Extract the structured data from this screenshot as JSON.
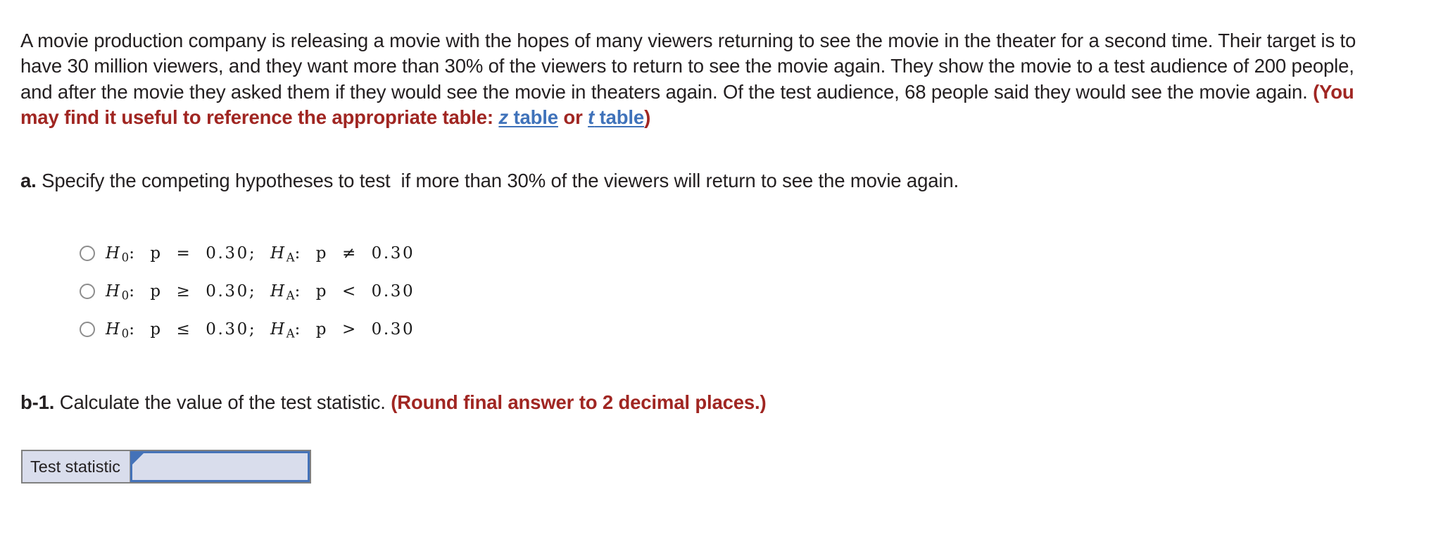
{
  "problem": {
    "text_part_1": "A movie production company is releasing a movie with the hopes of many viewers returning to see the movie in the theater for a second time. Their target is to have 30 million viewers, and they want more than 30% of the viewers to return to see the movie again. They show the movie to a test audience of 200 people, and after the movie they asked them if they would see the movie in theaters again. Of the test audience, 68 people said they would see the movie again. ",
    "reference_note_open": "(You may find it useful to reference the appropriate table: ",
    "z_table_prefix": "z",
    "z_table_suffix": " table",
    "conjunction": " or ",
    "t_table_prefix": "t",
    "t_table_suffix": " table",
    "reference_note_close": ")"
  },
  "part_a": {
    "label": "a.",
    "question": " Specify the competing hypotheses to test  if more than 30% of the viewers will return to see the movie again.",
    "options": [
      {
        "id": "option-1",
        "null_symbol": "H",
        "null_sub": "0",
        "null_body": ":  p  =  0.30;  ",
        "alt_symbol": "H",
        "alt_sub": "A",
        "alt_body": ":  p  ≠  0.30",
        "selected": false
      },
      {
        "id": "option-2",
        "null_symbol": "H",
        "null_sub": "0",
        "null_body": ":  p  ≥  0.30;  ",
        "alt_symbol": "H",
        "alt_sub": "A",
        "alt_body": ":  p  <  0.30",
        "selected": false
      },
      {
        "id": "option-3",
        "null_symbol": "H",
        "null_sub": "0",
        "null_body": ":  p  ≤  0.30;  ",
        "alt_symbol": "H",
        "alt_sub": "A",
        "alt_body": ":  p  >  0.30",
        "selected": false
      }
    ]
  },
  "part_b": {
    "label": "b-1.",
    "question": " Calculate the value of the test statistic. ",
    "rounding_note": "(Round final answer to 2 decimal places.)"
  },
  "answer_table": {
    "row_label": "Test statistic",
    "value": "",
    "placeholder": ""
  },
  "colors": {
    "body_text": "#231f20",
    "emphasis_red": "#a02622",
    "link_blue": "#3f72ba",
    "cell_fill": "#d9ddec",
    "cell_border_blue": "#4472b8",
    "table_border_gray": "#808080",
    "radio_border": "#8d8d8d"
  }
}
